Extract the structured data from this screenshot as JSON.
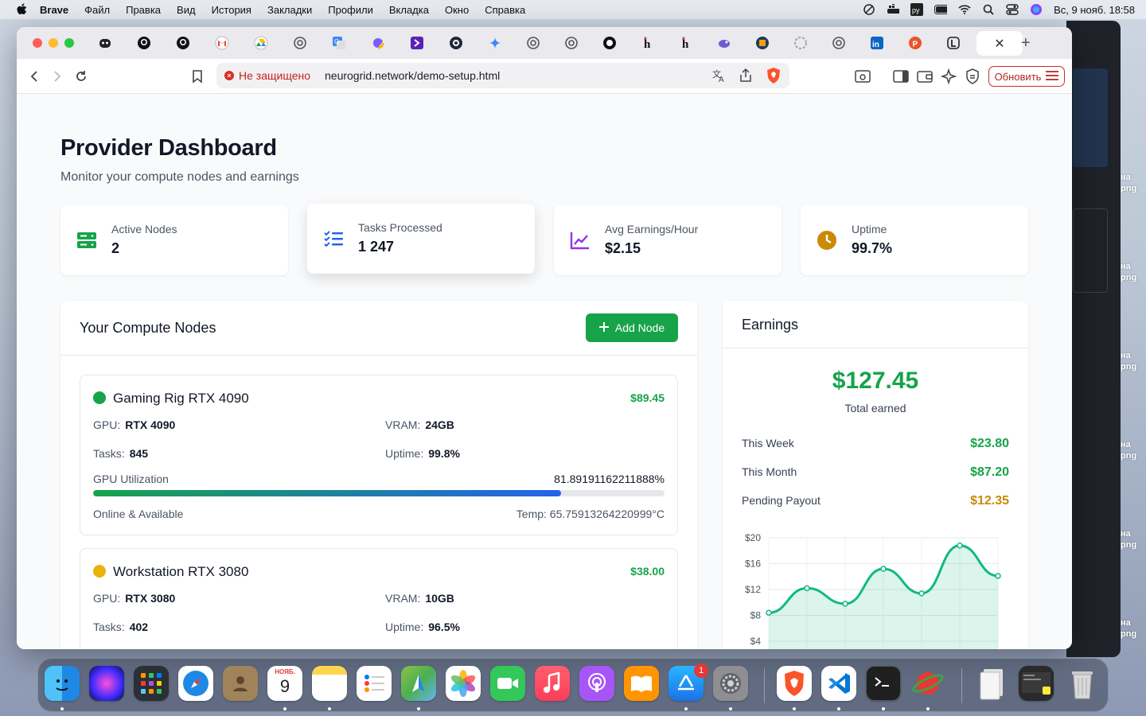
{
  "menubar": {
    "app_name": "Brave",
    "items": [
      "Файл",
      "Правка",
      "Вид",
      "История",
      "Закладки",
      "Профили",
      "Вкладка",
      "Окно",
      "Справка"
    ],
    "clock": "Вс, 9 нояб.  18:58"
  },
  "browser": {
    "tab_close": "✕",
    "new_tab": "+",
    "address": {
      "security_label": "Не защищено",
      "url": "neurogrid.network/demo-setup.html"
    },
    "update_label": "Обновить"
  },
  "dashboard": {
    "title": "Provider Dashboard",
    "subtitle": "Monitor your compute nodes and earnings",
    "stats": [
      {
        "label": "Active Nodes",
        "value": "2",
        "icon": "server-icon",
        "color": "#16a34a"
      },
      {
        "label": "Tasks Processed",
        "value": "1 247",
        "icon": "tasks-icon",
        "color": "#2563eb"
      },
      {
        "label": "Avg Earnings/Hour",
        "value": "$2.15",
        "icon": "chart-line-icon",
        "color": "#9333ea"
      },
      {
        "label": "Uptime",
        "value": "99.7%",
        "icon": "clock-icon",
        "color": "#ca8a04"
      }
    ],
    "nodes_panel": {
      "title": "Your Compute Nodes",
      "add_button": "Add Node",
      "nodes": [
        {
          "name": "Gaming Rig RTX 4090",
          "earnings": "$89.45",
          "status_color": "#16a34a",
          "gpu_label": "GPU:",
          "gpu": "RTX 4090",
          "vram_label": "VRAM:",
          "vram": "24GB",
          "tasks_label": "Tasks:",
          "tasks": "845",
          "uptime_label": "Uptime:",
          "uptime": "99.8%",
          "util_label": "GPU Utilization",
          "util_value": "81.89191162211888%",
          "util_fraction": 0.8189,
          "status": "Online & Available",
          "temp": "Temp: 65.75913264220999°C"
        },
        {
          "name": "Workstation RTX 3080",
          "earnings": "$38.00",
          "status_color": "#eab308",
          "gpu_label": "GPU:",
          "gpu": "RTX 3080",
          "vram_label": "VRAM:",
          "vram": "10GB",
          "tasks_label": "Tasks:",
          "tasks": "402",
          "uptime_label": "Uptime:",
          "uptime": "96.5%"
        }
      ]
    },
    "earnings_panel": {
      "title": "Earnings",
      "total": "$127.45",
      "total_label": "Total earned",
      "rows": [
        {
          "label": "This Week",
          "value": "$23.80",
          "color": "#16a34a"
        },
        {
          "label": "This Month",
          "value": "$87.20",
          "color": "#16a34a"
        },
        {
          "label": "Pending Payout",
          "value": "$12.35",
          "color": "#ca8a04"
        }
      ]
    }
  },
  "chart_data": {
    "type": "area",
    "y_ticks": [
      "$20",
      "$16",
      "$12",
      "$8",
      "$4"
    ],
    "y_tick_values": [
      20,
      16,
      12,
      8,
      4
    ],
    "ylim": [
      4,
      20
    ],
    "series": [
      {
        "values": [
          8.4,
          12.2,
          9.8,
          15.2,
          11.4,
          18.8,
          14.1
        ]
      }
    ],
    "color": "#10b981",
    "grid": true
  },
  "dock": {
    "calendar_month": "НОЯБ.",
    "calendar_day": "9",
    "appstore_badge": "1"
  }
}
